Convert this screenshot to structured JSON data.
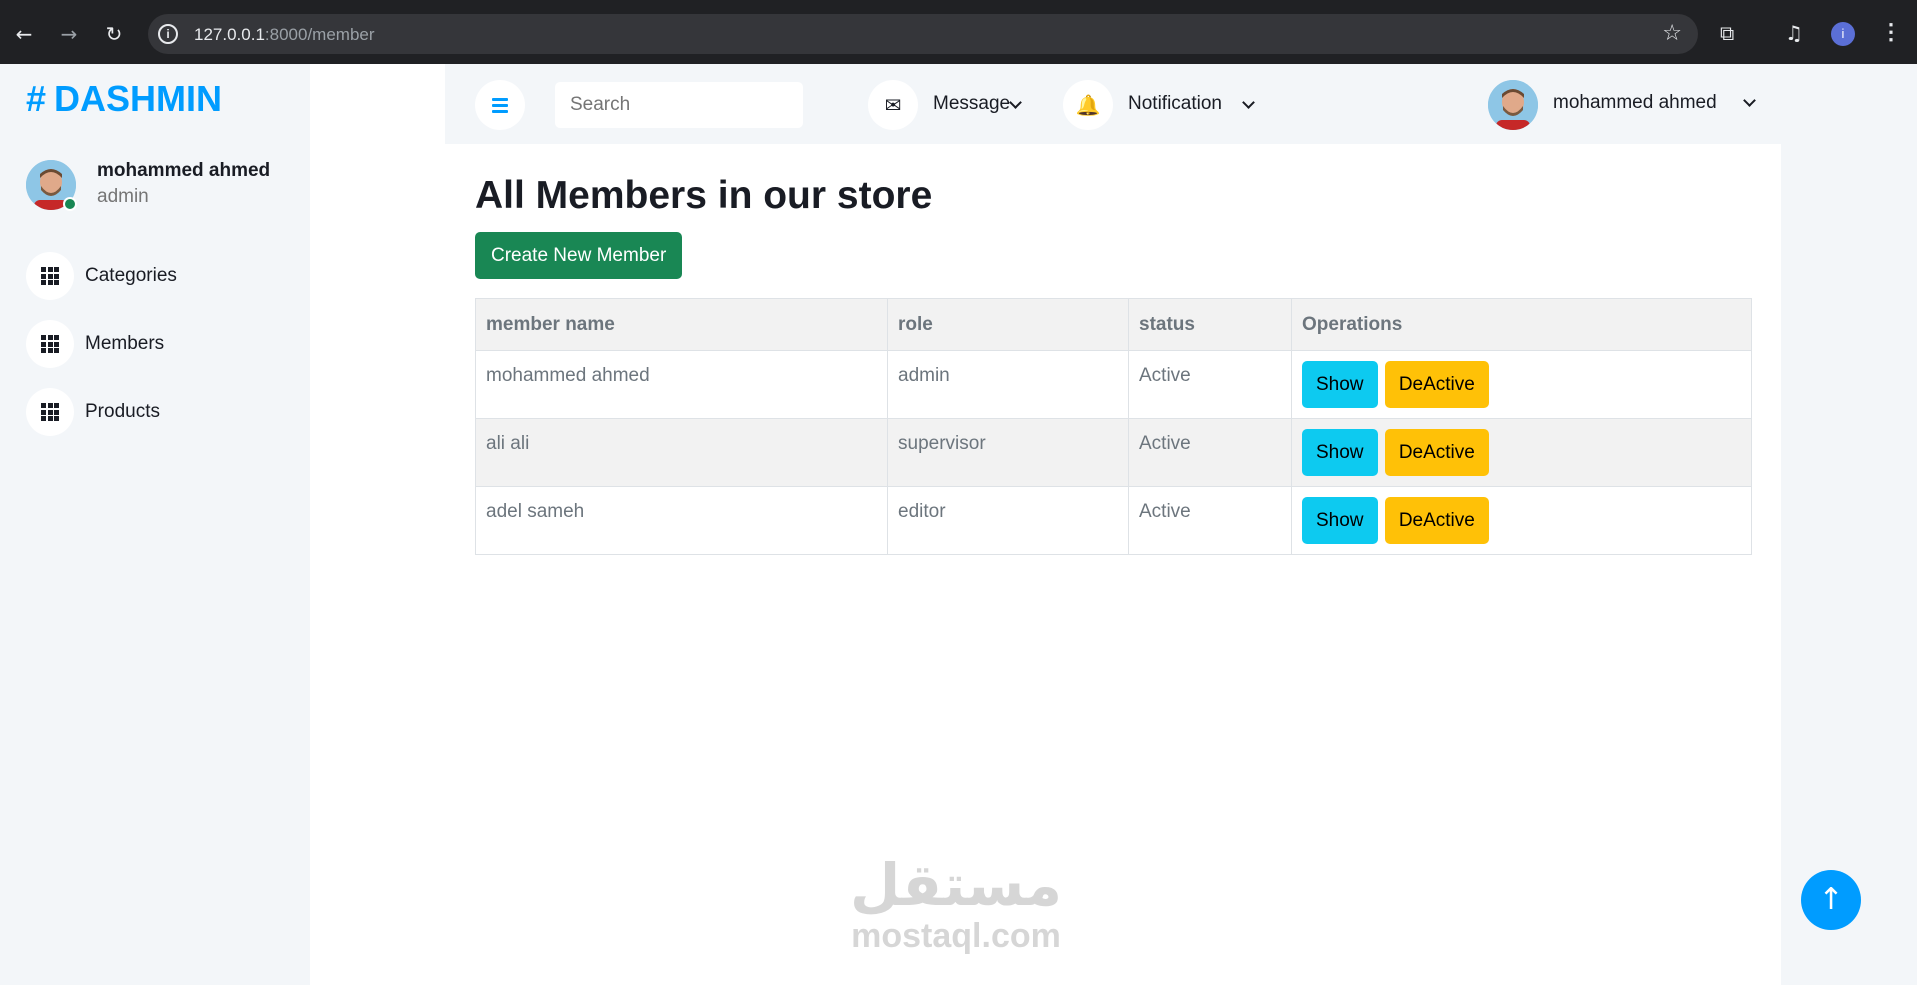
{
  "browser": {
    "url_host": "127.0.0.1",
    "url_path": ":8000/member",
    "back_icon": "←",
    "forward_icon": "→",
    "reload_icon": "↻",
    "star_icon": "☆",
    "profile_initial": "i"
  },
  "sidebar": {
    "brand": "DASHMIN",
    "brand_hash": "#",
    "user_name": "mohammed ahmed",
    "user_role": "admin",
    "items": [
      {
        "label": "Categories"
      },
      {
        "label": "Members"
      },
      {
        "label": "Products"
      }
    ]
  },
  "topnav": {
    "search_placeholder": "Search",
    "message_label": "Message",
    "notification_label": "Notification",
    "user_name": "mohammed ahmed",
    "message_icon": "✉",
    "notification_icon": "🔔"
  },
  "main": {
    "title": "All Members in our store",
    "create_button": "Create New Member",
    "columns": [
      "member name",
      "role",
      "status",
      "Operations"
    ],
    "rows": [
      {
        "name": "mohammed ahmed",
        "role": "admin",
        "status": "Active",
        "show": "Show",
        "deactive": "DeActive"
      },
      {
        "name": "ali ali",
        "role": "supervisor",
        "status": "Active",
        "show": "Show",
        "deactive": "DeActive"
      },
      {
        "name": "adel sameh",
        "role": "editor",
        "status": "Active",
        "show": "Show",
        "deactive": "DeActive"
      }
    ]
  },
  "watermark": {
    "arabic": "مستقل",
    "latin": "mostaql.com"
  },
  "back_to_top_icon": "↑",
  "colors": {
    "primary": "#009cff",
    "sidebar_bg": "#f3f6f9",
    "create_button": "#198754",
    "show_button": "#0dcaf0",
    "deactive_button": "#ffc107"
  }
}
